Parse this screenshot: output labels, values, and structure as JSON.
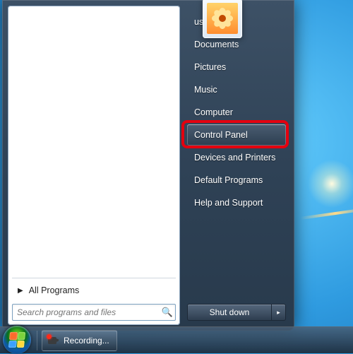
{
  "user_name": "user",
  "menu": {
    "items": [
      {
        "label": "user"
      },
      {
        "label": "Documents"
      },
      {
        "label": "Pictures"
      },
      {
        "label": "Music"
      },
      {
        "label": "Computer"
      },
      {
        "label": "Control Panel"
      },
      {
        "label": "Devices and Printers"
      },
      {
        "label": "Default Programs"
      },
      {
        "label": "Help and Support"
      }
    ],
    "highlighted_index": 5
  },
  "all_programs_label": "All Programs",
  "search": {
    "placeholder": "Search programs and files"
  },
  "shutdown": {
    "label": "Shut down",
    "arrow": "▸"
  },
  "taskbar": {
    "app_label": "Recording..."
  }
}
